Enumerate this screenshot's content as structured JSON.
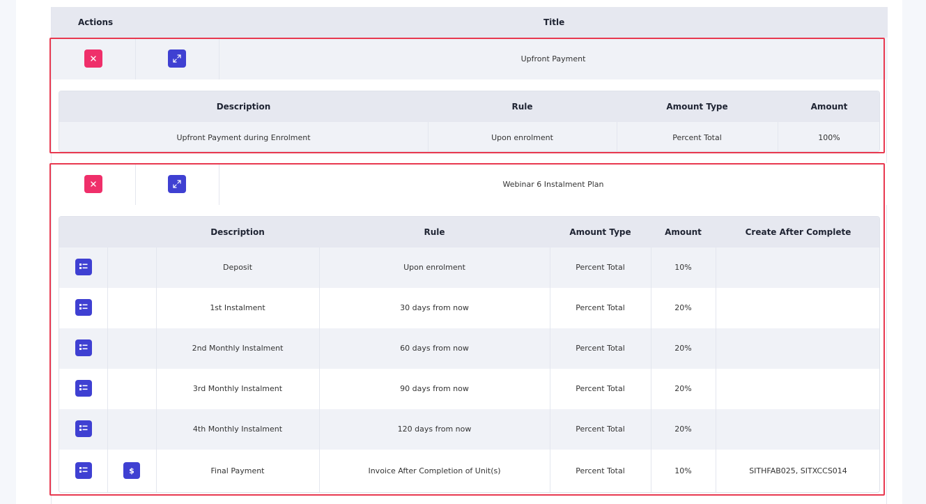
{
  "header": {
    "actions_label": "Actions",
    "title_label": "Title"
  },
  "icons": {
    "delete": "close-icon",
    "expand": "expand-icon",
    "list": "list-icon",
    "dollar": "dollar-icon"
  },
  "colors": {
    "delete": "#ef2f6a",
    "primary": "#3f40d2",
    "highlight": "#e8384f"
  },
  "plans": [
    {
      "title": "Upfront Payment",
      "columns": [
        "Description",
        "Rule",
        "Amount Type",
        "Amount"
      ],
      "rows": [
        {
          "description": "Upfront Payment during Enrolment",
          "rule": "Upon enrolment",
          "amount_type": "Percent Total",
          "amount": "100%"
        }
      ]
    },
    {
      "title": "Webinar 6 Instalment Plan",
      "columns": [
        "Description",
        "Rule",
        "Amount Type",
        "Amount",
        "Create After Complete"
      ],
      "rows": [
        {
          "description": "Deposit",
          "rule": "Upon enrolment",
          "amount_type": "Percent Total",
          "amount": "10%",
          "create_after": ""
        },
        {
          "description": "1st Instalment",
          "rule": "30 days from now",
          "amount_type": "Percent Total",
          "amount": "20%",
          "create_after": ""
        },
        {
          "description": "2nd Monthly Instalment",
          "rule": "60 days from now",
          "amount_type": "Percent Total",
          "amount": "20%",
          "create_after": ""
        },
        {
          "description": "3rd Monthly Instalment",
          "rule": "90 days from now",
          "amount_type": "Percent Total",
          "amount": "20%",
          "create_after": ""
        },
        {
          "description": "4th Monthly Instalment",
          "rule": "120 days from now",
          "amount_type": "Percent Total",
          "amount": "20%",
          "create_after": ""
        },
        {
          "description": "Final Payment",
          "rule": "Invoice After Completion of Unit(s)",
          "amount_type": "Percent Total",
          "amount": "10%",
          "create_after": "SITHFAB025, SITXCCS014",
          "dollar_label": "$"
        }
      ]
    }
  ]
}
